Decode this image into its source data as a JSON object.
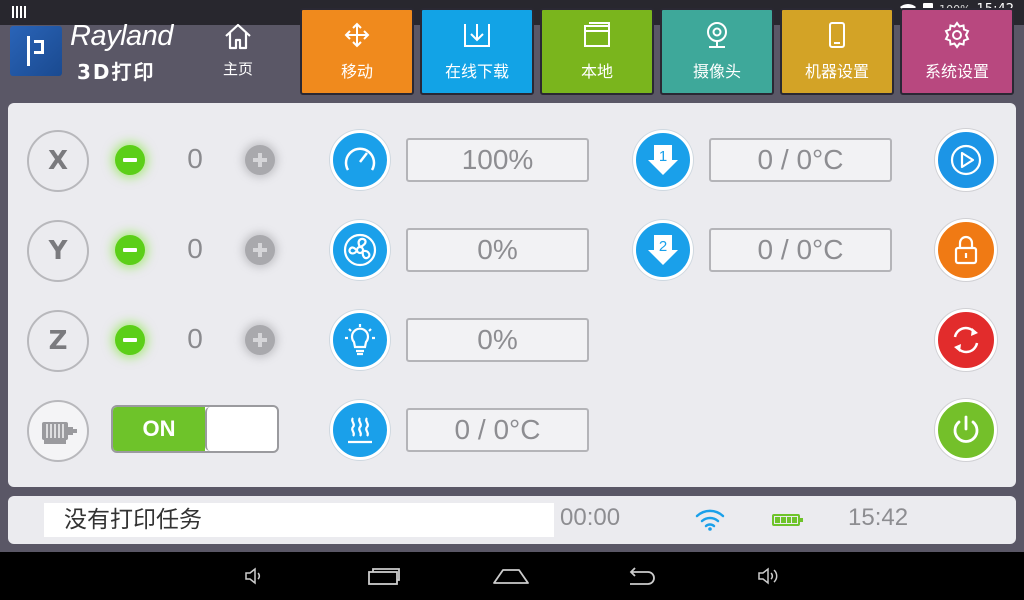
{
  "statusbar": {
    "battery_pct": "100%",
    "time": "15:42"
  },
  "header": {
    "brand": "Rayland",
    "brand_sub": "3D打印",
    "home_label": "主页",
    "tiles": [
      {
        "label": "移动",
        "color": "#f08a1d",
        "icon": "move-icon"
      },
      {
        "label": "在线下载",
        "color": "#12a3e6",
        "icon": "download-icon"
      },
      {
        "label": "本地",
        "color": "#7ab51d",
        "icon": "folder-icon"
      },
      {
        "label": "摄像头",
        "color": "#3ea89a",
        "icon": "webcam-icon"
      },
      {
        "label": "机器设置",
        "color": "#d3a326",
        "icon": "phone-icon"
      },
      {
        "label": "系统设置",
        "color": "#b8487f",
        "icon": "gear-icon"
      }
    ]
  },
  "axes": [
    {
      "name": "X",
      "value": "0"
    },
    {
      "name": "Y",
      "value": "0"
    },
    {
      "name": "Z",
      "value": "0"
    }
  ],
  "motor_toggle": {
    "label": "ON"
  },
  "readouts": {
    "speed": "100%",
    "fan": "0%",
    "light": "0%",
    "bed": "0 / 0°C",
    "extruder1": "0 / 0°C",
    "extruder2": "0 / 0°C",
    "extruder1_num": "1",
    "extruder2_num": "2"
  },
  "controls": {
    "play_color": "#1c95e6",
    "lock_color": "#f07a14",
    "refresh_color": "#e22c2c",
    "power_color": "#74c02a"
  },
  "infobar": {
    "task": "没有打印任务",
    "timer": "00:00",
    "clock": "15:42"
  }
}
